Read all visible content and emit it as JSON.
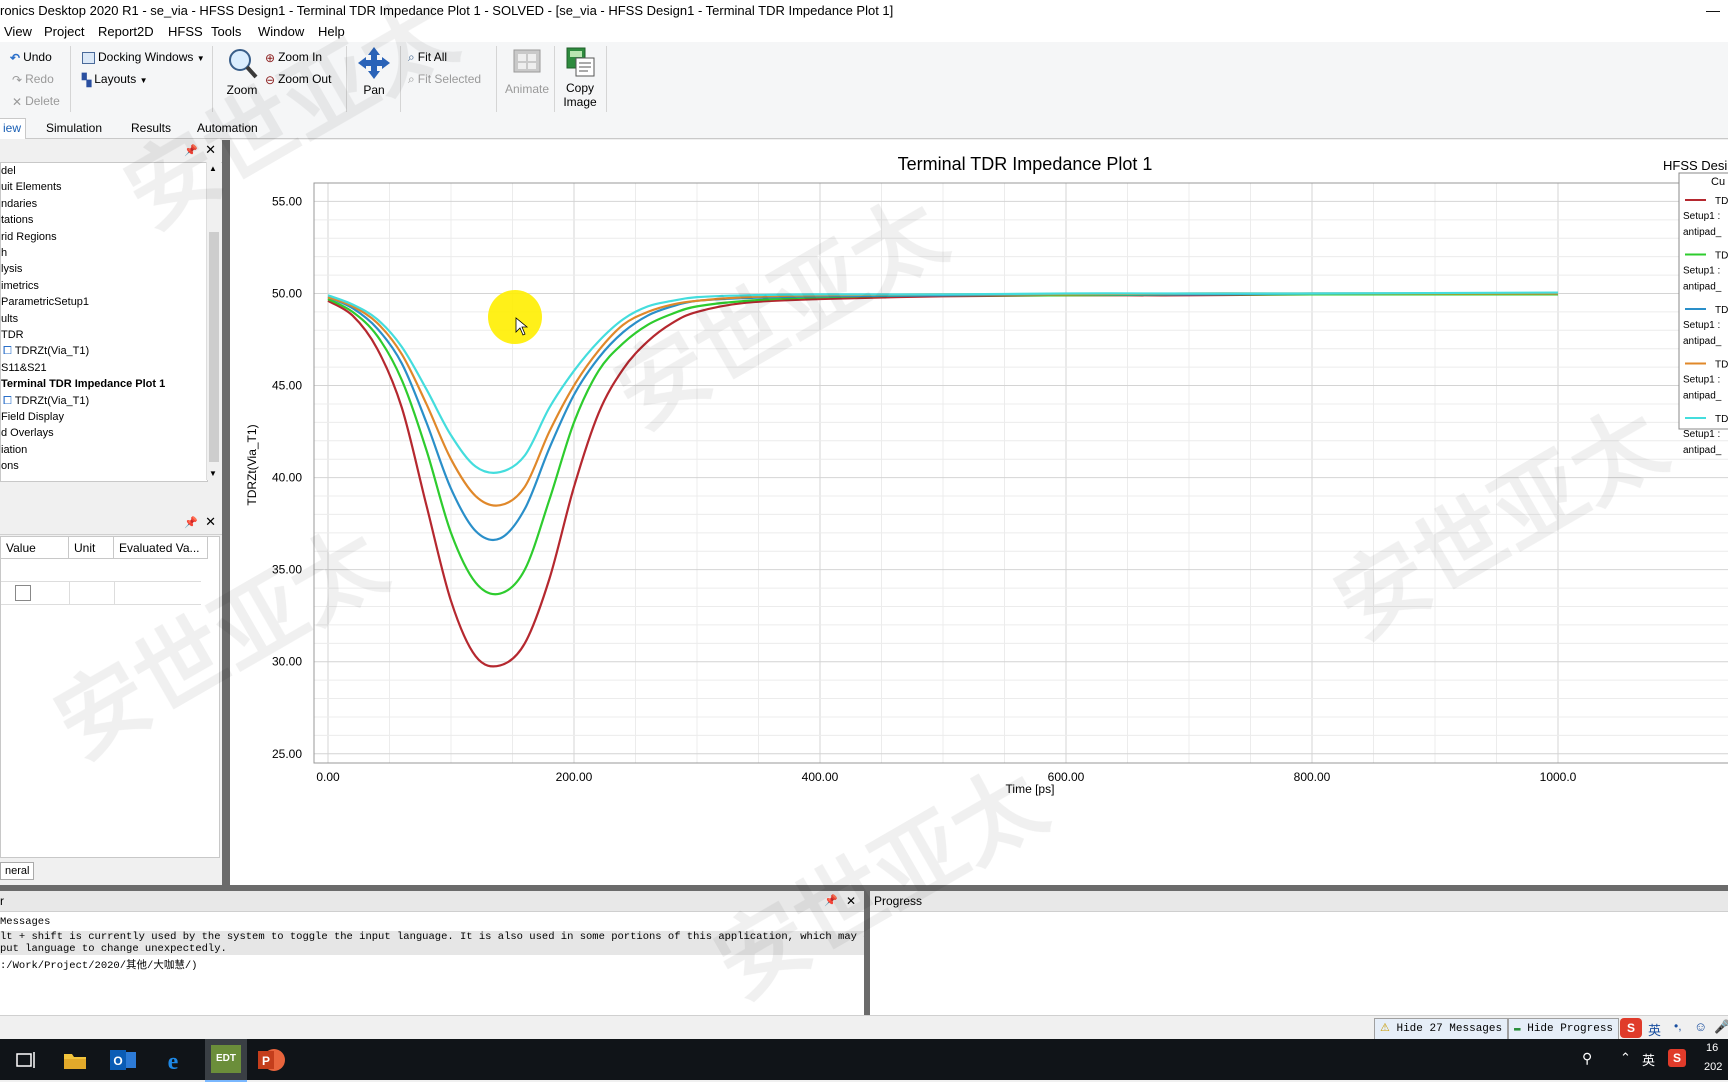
{
  "window": {
    "title": "ronics Desktop 2020 R1 - se_via - HFSS Design1 - Terminal TDR Impedance Plot 1 - SOLVED - [se_via - HFSS Design1 - Terminal TDR Impedance Plot 1]"
  },
  "menu": [
    "View",
    "Project",
    "Report2D",
    "HFSS",
    "Tools",
    "Window",
    "Help"
  ],
  "ribbon": {
    "undo": "Undo",
    "redo": "Redo",
    "delete": "Delete",
    "docking": "Docking Windows",
    "layouts": "Layouts",
    "zoom": "Zoom",
    "zoom_in": "Zoom In",
    "zoom_out": "Zoom Out",
    "pan": "Pan",
    "fit_all": "Fit All",
    "fit_selected": "Fit Selected",
    "animate": "Animate",
    "copy_image_1": "Copy",
    "copy_image_2": "Image"
  },
  "tabs": [
    "iew",
    "Simulation",
    "Results",
    "Automation"
  ],
  "tree": [
    {
      "label": "del",
      "bold": false
    },
    {
      "label": "uit Elements",
      "bold": false
    },
    {
      "label": "ndaries",
      "bold": false
    },
    {
      "label": "tations",
      "bold": false
    },
    {
      "label": "rid Regions",
      "bold": false
    },
    {
      "label": "h",
      "bold": false
    },
    {
      "label": "lysis",
      "bold": false
    },
    {
      "label": "imetrics",
      "bold": false
    },
    {
      "label": "ParametricSetup1",
      "bold": false
    },
    {
      "label": "ults",
      "bold": false
    },
    {
      "label": "TDR",
      "bold": false
    },
    {
      "label": "TDRZt(Via_T1)",
      "bold": false,
      "icon": true
    },
    {
      "label": "S11&S21",
      "bold": false
    },
    {
      "label": "Terminal TDR Impedance Plot 1",
      "bold": true
    },
    {
      "label": "TDRZt(Via_T1)",
      "bold": false,
      "icon": true
    },
    {
      "label": "Field Display",
      "bold": false
    },
    {
      "label": "d Overlays",
      "bold": false
    },
    {
      "label": "iation",
      "bold": false
    },
    {
      "label": "ons",
      "bold": false
    }
  ],
  "props": {
    "col_value": "Value",
    "col_unit": "Unit",
    "col_eval": "Evaluated Va...",
    "tab": "neral"
  },
  "messages": {
    "header": "r",
    "lines": [
      " Messages",
      "lt + shift is currently used by the system to toggle the input language. It is also used in some portions of this application, which may cause",
      "put language to change unexpectedly.",
      ":/Work/Project/2020/其他/大咖慧/)"
    ]
  },
  "progress": {
    "header": "Progress"
  },
  "status": {
    "hide_messages": "Hide 27 Messages",
    "hide_progress": "Hide Progress",
    "ime": "英"
  },
  "tray": {
    "ime": "英",
    "clock_partial_1": "16",
    "clock_partial_2": "202"
  },
  "colors": {
    "red": "#b5282f",
    "green": "#2ecc2e",
    "blue": "#2a8fc9",
    "orange": "#e0882a",
    "cyan": "#44dddd",
    "cursor_highlight": "#ffee00"
  },
  "chart_data": {
    "type": "line",
    "title": "Terminal TDR Impedance Plot 1",
    "design_label": "HFSS Desi",
    "xlabel": "Time [ps]",
    "ylabel": "TDRZt(Via_T1)",
    "xlim": [
      0,
      1000
    ],
    "ylim": [
      24.5,
      56
    ],
    "xticks": [
      "0.00",
      "200.00",
      "400.00",
      "600.00",
      "800.00",
      "1000.0"
    ],
    "xtick_values": [
      0,
      200,
      400,
      600,
      800,
      1000
    ],
    "yticks": [
      "25.00",
      "30.00",
      "35.00",
      "40.00",
      "45.00",
      "50.00",
      "55.00"
    ],
    "ytick_values": [
      25,
      30,
      35,
      40,
      45,
      50,
      55
    ],
    "grid": true,
    "legend": {
      "position": "right",
      "header": "Cu",
      "entries": [
        {
          "line1": "TD",
          "line2": "Setup1 :",
          "line3": "antipad_"
        },
        {
          "line1": "TD",
          "line2": "Setup1 :",
          "line3": "antipad_"
        },
        {
          "line1": "TD",
          "line2": "Setup1 :",
          "line3": "antipad_"
        },
        {
          "line1": "TD",
          "line2": "Setup1 :",
          "line3": "antipad_"
        },
        {
          "line1": "TD",
          "line2": "Setup1 :",
          "line3": "antipad_"
        }
      ]
    },
    "x": [
      0,
      20,
      40,
      60,
      80,
      100,
      120,
      140,
      160,
      180,
      200,
      220,
      240,
      260,
      280,
      300,
      340,
      400,
      500,
      600,
      700,
      800,
      1000
    ],
    "series": [
      {
        "color": "#b5282f",
        "values": [
          49.6,
          48.8,
          47.0,
          43.8,
          38.5,
          33.3,
          30.3,
          29.8,
          31.0,
          34.5,
          39.5,
          43.5,
          45.9,
          47.4,
          48.4,
          49.0,
          49.5,
          49.7,
          49.85,
          49.9,
          49.9,
          49.95,
          49.95
        ]
      },
      {
        "color": "#2ecc2e",
        "values": [
          49.7,
          49.0,
          47.7,
          45.3,
          41.5,
          37.0,
          34.3,
          33.7,
          35.0,
          38.8,
          43.0,
          45.8,
          47.3,
          48.3,
          48.9,
          49.3,
          49.6,
          49.8,
          49.9,
          49.9,
          49.95,
          49.95,
          49.95
        ]
      },
      {
        "color": "#2a8fc9",
        "values": [
          49.8,
          49.2,
          48.1,
          46.2,
          43.0,
          39.4,
          37.1,
          36.7,
          38.3,
          41.6,
          44.5,
          46.5,
          47.9,
          48.8,
          49.3,
          49.6,
          49.75,
          49.85,
          49.9,
          49.95,
          49.95,
          50.0,
          50.0
        ]
      },
      {
        "color": "#e0882a",
        "values": [
          49.8,
          49.3,
          48.4,
          46.7,
          44.0,
          41.0,
          39.0,
          38.5,
          39.5,
          42.5,
          45.0,
          46.9,
          48.3,
          49.0,
          49.4,
          49.6,
          49.8,
          49.9,
          49.95,
          49.95,
          50.0,
          50.0,
          50.0
        ]
      },
      {
        "color": "#44dddd",
        "values": [
          49.9,
          49.4,
          48.6,
          47.1,
          44.8,
          42.3,
          40.6,
          40.3,
          41.2,
          43.8,
          45.8,
          47.4,
          48.6,
          49.3,
          49.6,
          49.8,
          49.9,
          49.95,
          49.95,
          50.0,
          50.0,
          50.0,
          50.05
        ]
      }
    ]
  }
}
